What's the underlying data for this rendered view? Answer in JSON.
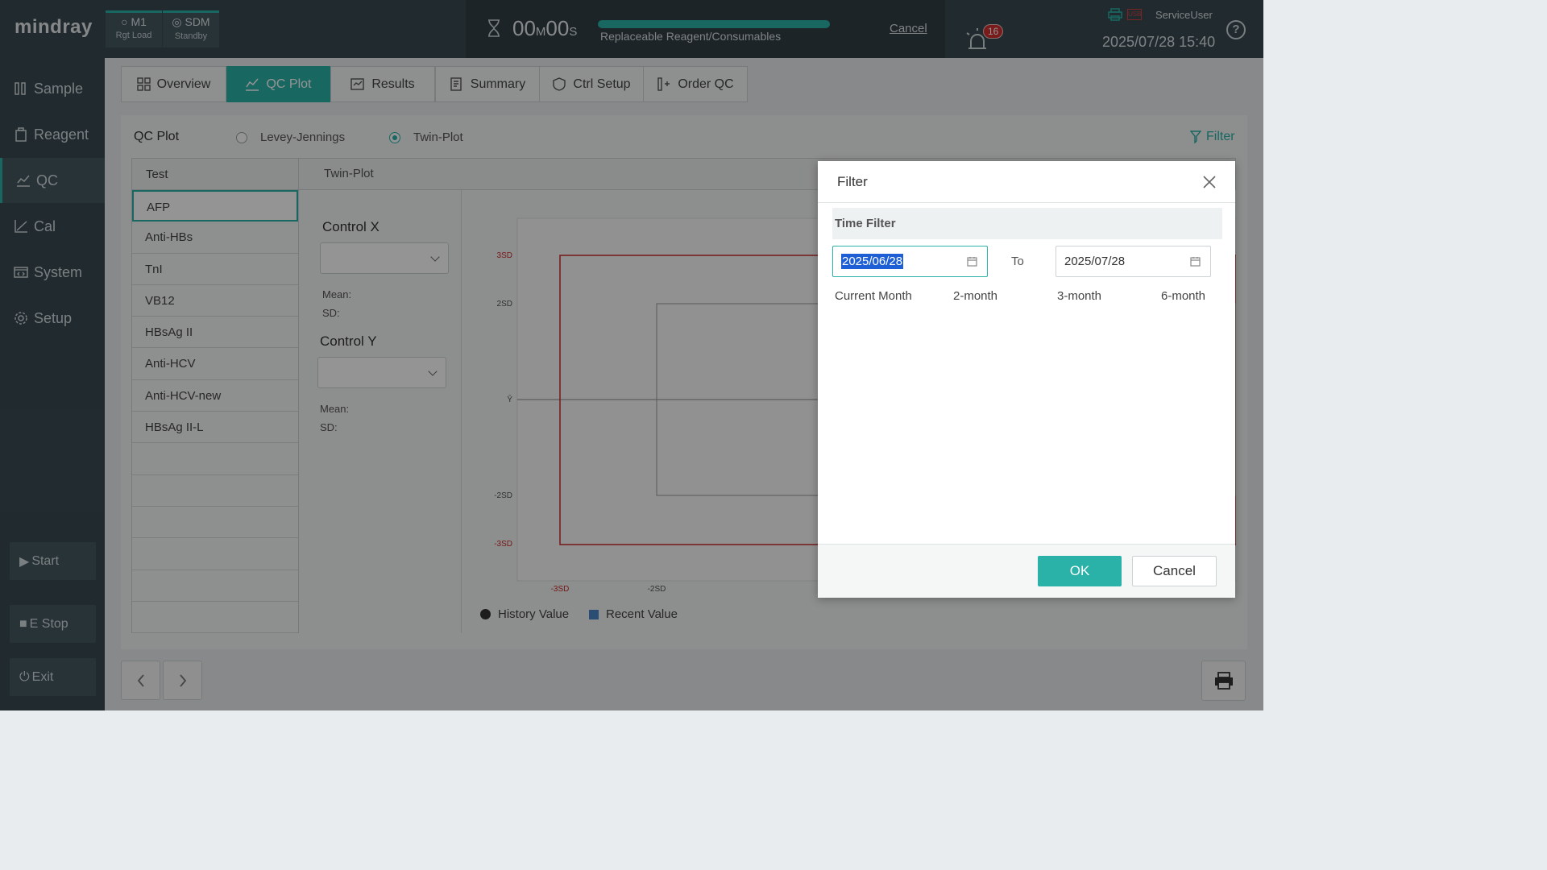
{
  "topbar": {
    "logo": "mindray",
    "tiles": [
      {
        "title": "M1",
        "sub": "Rgt Load"
      },
      {
        "title": "SDM",
        "sub": "Standby"
      }
    ],
    "timer": {
      "minutes": "00",
      "minute_unit": "M",
      "seconds": "00",
      "second_unit": "S"
    },
    "progress": {
      "fraction": 1.0,
      "label": "Replaceable Reagent/Consumables"
    },
    "cancel_label": "Cancel",
    "alarm_count": "16",
    "usb_label": "USB",
    "user": "ServiceUser",
    "datetime": "2025/07/28 15:40",
    "help": "?"
  },
  "sidebar": {
    "items": [
      {
        "label": "Sample",
        "icon": "sample-icon"
      },
      {
        "label": "Reagent",
        "icon": "reagent-icon"
      },
      {
        "label": "QC",
        "icon": "qc-icon"
      },
      {
        "label": "Cal",
        "icon": "cal-icon"
      },
      {
        "label": "System",
        "icon": "system-icon"
      },
      {
        "label": "Setup",
        "icon": "gear-icon"
      }
    ],
    "active": "QC",
    "start": "Start",
    "estop": "E Stop",
    "exit": "Exit"
  },
  "tabs": [
    {
      "label": "Overview"
    },
    {
      "label": "QC Plot"
    },
    {
      "label": "Results"
    },
    {
      "label": "Summary"
    },
    {
      "label": "Ctrl Setup"
    },
    {
      "label": "Order QC"
    }
  ],
  "active_tab": "QC Plot",
  "qc_plot": {
    "title": "QC Plot",
    "modes": [
      {
        "label": "Levey-Jennings",
        "selected": false
      },
      {
        "label": "Twin-Plot",
        "selected": true
      }
    ],
    "filter_label": "Filter",
    "test_header": "Test",
    "tests": [
      "AFP",
      "Anti-HBs",
      "TnI",
      "VB12",
      "HBsAg II",
      "Anti-HCV",
      "Anti-HCV-new",
      "HBsAg II-L",
      "",
      "",
      "",
      "",
      "",
      ""
    ],
    "selected_test": "AFP",
    "twin_header": "Twin-Plot",
    "control_x": {
      "label": "Control X",
      "value": "",
      "mean_label": "Mean:",
      "sd_label": "SD:"
    },
    "control_y": {
      "label": "Control Y",
      "value": "",
      "mean_label": "Mean:",
      "sd_label": "SD:"
    },
    "y_ticks": [
      "3SD",
      "2SD",
      "Ȳ",
      "-2SD",
      "-3SD"
    ],
    "x_ticks": [
      "-3SD",
      "-2SD"
    ],
    "legend": [
      {
        "label": "History Value"
      },
      {
        "label": "Recent Value"
      }
    ]
  },
  "filter_dialog": {
    "title": "Filter",
    "section": "Time Filter",
    "from_date": "2025/06/28",
    "to_label": "To",
    "to_date": "2025/07/28",
    "quick_ranges": [
      "Current Month",
      "2-month",
      "3-month",
      "6-month"
    ],
    "ok": "OK",
    "cancel": "Cancel"
  },
  "colors": {
    "accent": "#2ab1a8",
    "sd3": "#cc2b2b",
    "sidebar": "#3a4a52"
  }
}
